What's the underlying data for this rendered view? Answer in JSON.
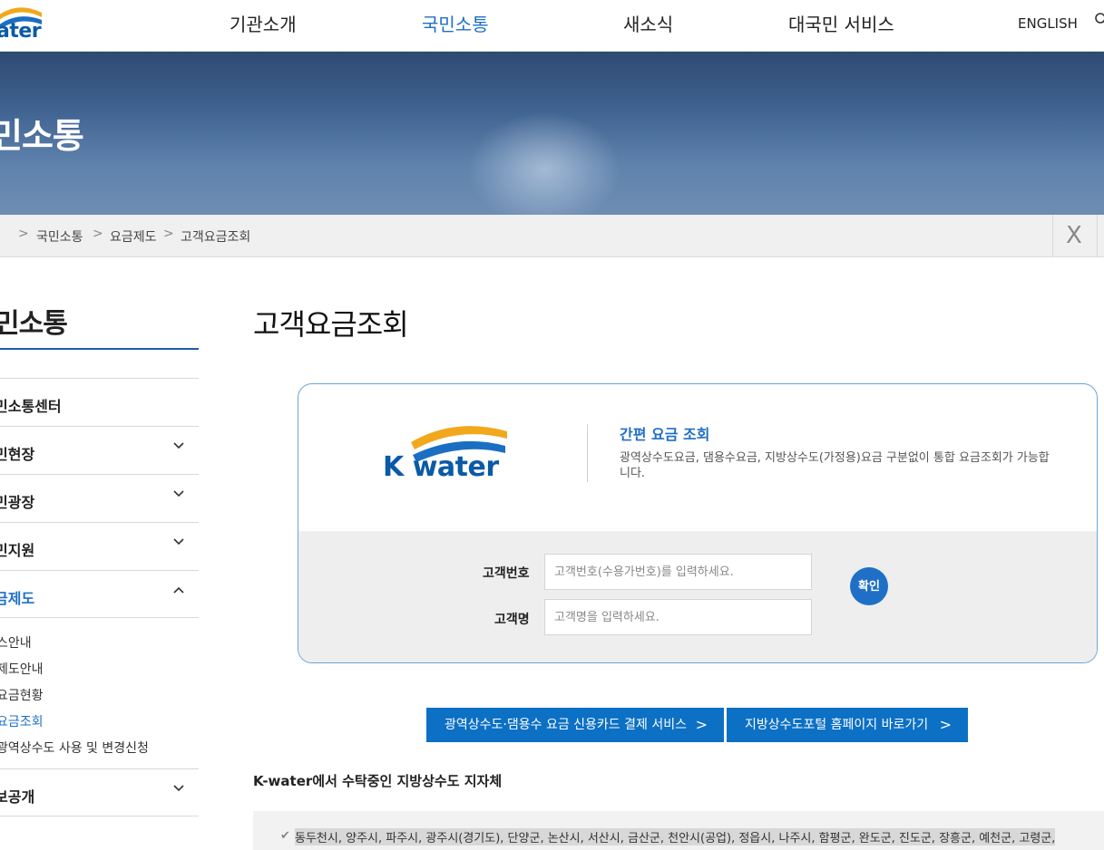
{
  "header": {
    "logo_text": "ater",
    "nav": [
      "기관소개",
      "국민소통",
      "새소식",
      "대국민 서비스"
    ],
    "active_nav": "국민소통",
    "lang": "ENGLISH"
  },
  "banner": {
    "title": "민소통"
  },
  "breadcrumb": {
    "items": [
      "국민소통",
      "요금제도",
      "고객요금조회"
    ],
    "close": "X"
  },
  "sidebar": {
    "title": "민소통",
    "items": [
      {
        "label": "민소통센터"
      },
      {
        "label": "민현장"
      },
      {
        "label": "민광장"
      },
      {
        "label": "민지원"
      },
      {
        "label": "금제도"
      },
      {
        "label": "보공개"
      }
    ],
    "sub_items": [
      "스안내",
      "제도안내",
      "요금현황",
      "요금조회",
      "광역상수도 사용 및 변경신청"
    ]
  },
  "main": {
    "title": "고객요금조회",
    "quick": {
      "logo_text": "K water",
      "title": "간편 요금 조회",
      "desc": "광역상수도요금, 댐용수요금, 지방상수도(가정용)요금 구분없이 통합 요금조회가 가능합니다."
    },
    "form": {
      "customer_no_label": "고객번호",
      "customer_no_placeholder": "고객번호(수용가번호)를 입력하세요.",
      "customer_name_label": "고객명",
      "customer_name_placeholder": "고객명을 입력하세요.",
      "submit": "확인"
    },
    "buttons": [
      {
        "label": "광역상수도·댐용수 요금 신용카드 결제 서비스"
      },
      {
        "label": "지방상수도포털 홈페이지 바로가기"
      }
    ],
    "section_title": "K-water에서 수탁중인 지방상수도 지자체",
    "region_list": "동두천시, 양주시, 파주시, 광주시(경기도), 단양군, 논산시, 서산시, 금산군, 천안시(공업), 정읍시, 나주시, 함평군, 완도군, 진도군, 장흥군, 예천군, 고령군,"
  }
}
